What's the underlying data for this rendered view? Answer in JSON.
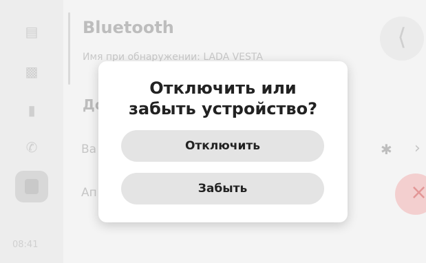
{
  "sidebar": {
    "icons": [
      "car-icon",
      "radio-icon",
      "phone-device-icon",
      "phone-call-icon",
      "media-icon"
    ],
    "clock": "08:41"
  },
  "header": {
    "title": "Bluetooth",
    "discovery_name": "Имя при обнаружении: LADA VESTA"
  },
  "devices": {
    "section_title": "До",
    "rows": [
      {
        "label": "Ва"
      },
      {
        "label": "Ап"
      }
    ]
  },
  "dialog": {
    "title": "Отключить или\nзабыть устройство?",
    "disconnect_label": "Отключить",
    "forget_label": "Забыть"
  },
  "colors": {
    "dialog_bg": "#ffffff",
    "button_bg": "#e4e4e4",
    "forget_accent": "#f3cfcf"
  }
}
